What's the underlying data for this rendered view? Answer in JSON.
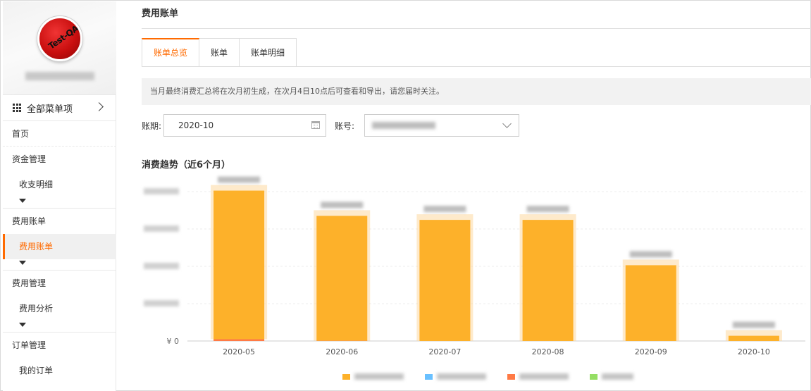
{
  "sidebar": {
    "avatar_text": "Test-QA",
    "all_menu_label": "全部菜单项",
    "items": [
      {
        "label": "首页"
      },
      {
        "label": "资金管理"
      },
      {
        "label": "收支明细"
      },
      {
        "label": "费用账单"
      },
      {
        "label": "费用账单"
      },
      {
        "label": "费用管理"
      },
      {
        "label": "费用分析"
      },
      {
        "label": "订单管理"
      },
      {
        "label": "我的订单"
      }
    ]
  },
  "main": {
    "title": "费用账单",
    "tabs": [
      {
        "label": "账单总览",
        "active": true
      },
      {
        "label": "账单"
      },
      {
        "label": "账单明细"
      }
    ],
    "notice": "当月最终消费汇总将在次月初生成，在次月4日10点后可查看和导出，请您届时关注。",
    "period_label": "账期:",
    "period_value": "2020-10",
    "account_label": "账号:",
    "trend_title": "消费趋势（近6个月）"
  },
  "chart_data": {
    "type": "bar",
    "stacked": true,
    "categories": [
      "2020-05",
      "2020-06",
      "2020-07",
      "2020-08",
      "2020-09",
      "2020-10"
    ],
    "series": [
      {
        "color": "#fdb12a",
        "values": [
          1000,
          840,
          815,
          815,
          510,
          35
        ]
      },
      {
        "color": "#69c0ff",
        "values": [
          0,
          0,
          0,
          0,
          0,
          0
        ]
      },
      {
        "color": "#ff7a45",
        "values": [
          12,
          2,
          0,
          0,
          0,
          0
        ]
      },
      {
        "color": "#95de64",
        "values": [
          0,
          0,
          0,
          0,
          0,
          0
        ]
      }
    ],
    "y_tick_labels": [
      "¥ 0"
    ],
    "ylim": [
      0,
      1100
    ],
    "grid": true,
    "legend_position": "bottom"
  }
}
